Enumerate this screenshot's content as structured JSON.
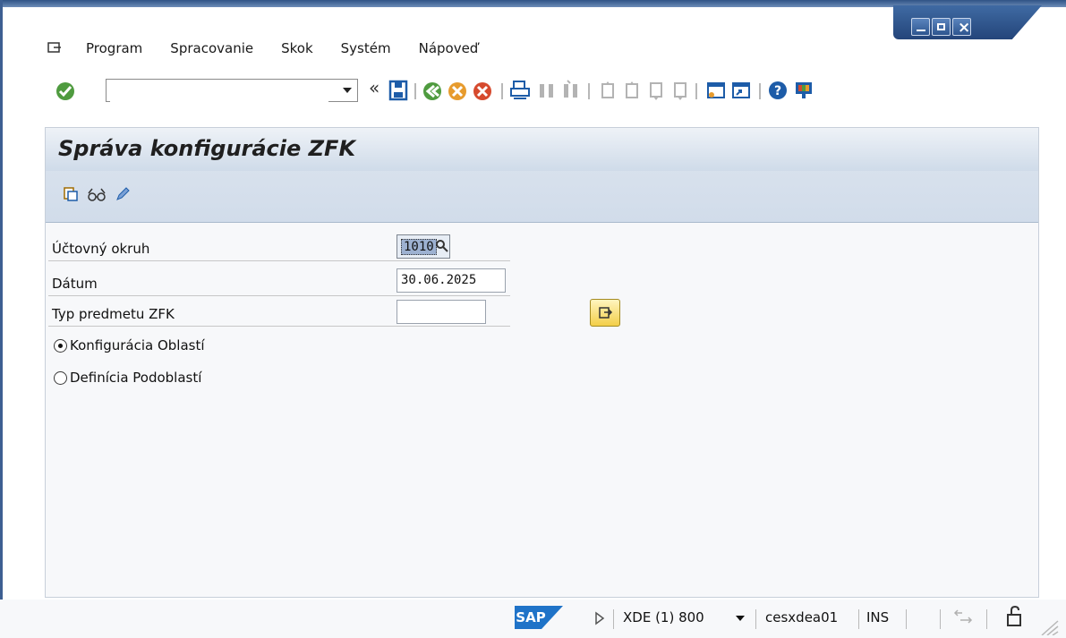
{
  "menu": {
    "items": [
      "Program",
      "Spracovanie",
      "Skok",
      "Systém",
      "Nápoveď"
    ]
  },
  "toolbar": {
    "command_field_value": "",
    "icons": [
      "enter-check-icon",
      "save-icon",
      "back-icon",
      "exit-icon",
      "cancel-icon",
      "print-icon",
      "find-icon",
      "find-next-icon",
      "first-page-icon",
      "previous-page-icon",
      "next-page-icon",
      "last-page-icon",
      "create-session-icon",
      "shortcut-icon",
      "help-icon",
      "customize-layout-icon"
    ]
  },
  "screen": {
    "title": "Správa konfigurácie ZFK",
    "app_toolbar_icons": [
      "copy-icon",
      "display-icon",
      "edit-pencil-icon"
    ]
  },
  "form": {
    "company_code_label": "Účtovný okruh",
    "company_code_value": "1010",
    "date_label": "Dátum",
    "date_value": "30.06.2025",
    "type_label": "Typ predmetu ZFK",
    "type_value": "",
    "radio1_label": "Konfigurácia Oblastí",
    "radio2_label": "Definícia Podoblastí"
  },
  "status": {
    "brand": "SAP",
    "system": "XDE (1) 800",
    "server": "cesxdea01",
    "mode": "INS"
  },
  "colors": {
    "frame_blue": "#3d5f92",
    "title_background": "#d1dcea",
    "sap_blue": "#1f73c8",
    "toolbar_green": "#4f9b3f",
    "toolbar_orange": "#e79b2d",
    "toolbar_red": "#d64a2e",
    "execute_button": "#f3cf49"
  }
}
